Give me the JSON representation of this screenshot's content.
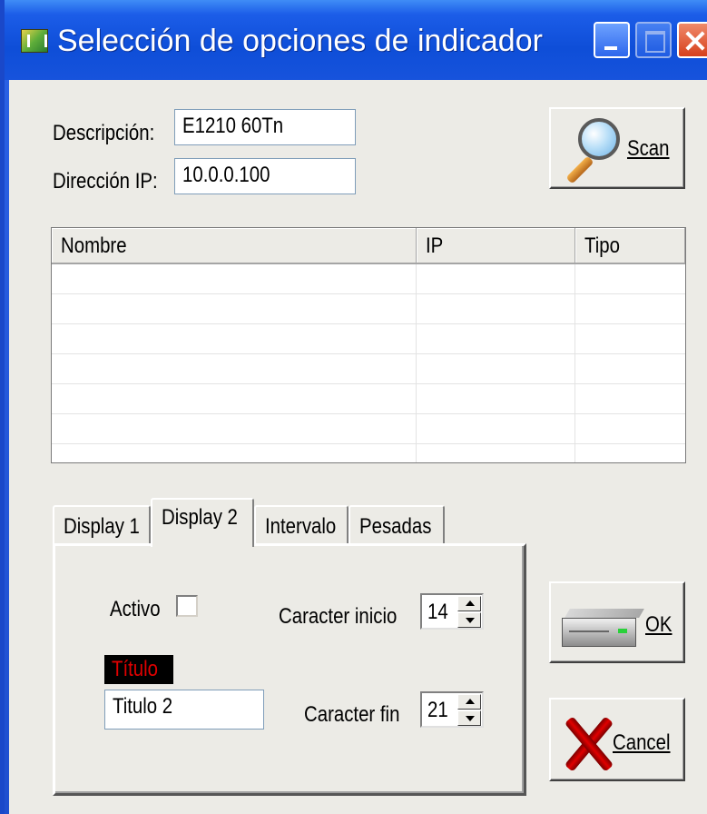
{
  "window": {
    "title": "Selección de opciones de indicador"
  },
  "form": {
    "descripcion_label": "Descripción:",
    "descripcion_value": "E1210 60Tn",
    "direccion_label": "Dirección IP:",
    "direccion_value": "10.0.0.100",
    "scan_label": "Scan"
  },
  "listview": {
    "columns": [
      "Nombre",
      "IP",
      "Tipo"
    ],
    "rows": []
  },
  "tabs": {
    "items": [
      "Display 1",
      "Display 2",
      "Intervalo",
      "Pesadas"
    ],
    "active": "Display 2"
  },
  "display2": {
    "activo_label": "Activo",
    "activo_checked": false,
    "titulo_label": "Título",
    "titulo_value": "Titulo 2",
    "caracter_inicio_label": "Caracter inicio",
    "caracter_inicio_value": "14",
    "caracter_fin_label": "Caracter fin",
    "caracter_fin_value": "21"
  },
  "buttons": {
    "ok_label": "OK",
    "cancel_label": "Cancel"
  },
  "colors": {
    "titlebar": "#0e4ed8",
    "client_bg": "#ecebe6",
    "titulo_text": "#e00000"
  }
}
